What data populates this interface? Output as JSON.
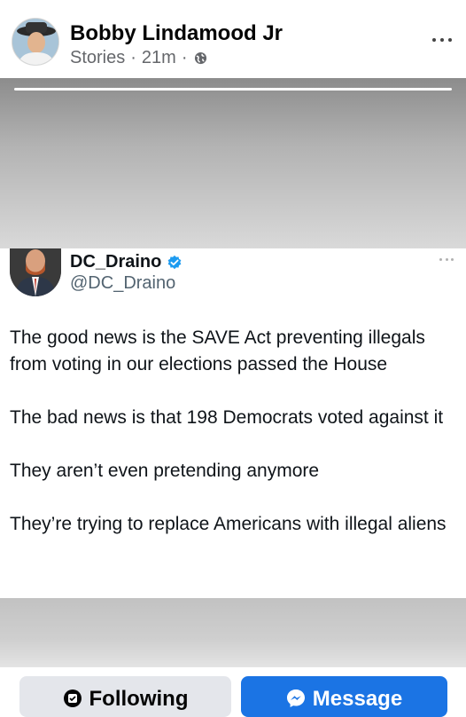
{
  "post": {
    "author_name": "Bobby Lindamood Jr",
    "source": "Stories",
    "separator": "·",
    "time_ago": "21m",
    "audience_icon": "globe-icon",
    "more_icon": "more-horizontal-icon"
  },
  "tweet": {
    "display_name": "DC_Draino",
    "verified_icon": "verified-badge-icon",
    "handle": "@DC_Draino",
    "paragraphs": [
      "The good news is the SAVE Act preventing illegals from voting in our elections passed the House",
      "The bad news is that 198 Democrats voted against it",
      "They aren’t even pretending anymore",
      "They’re trying to replace Americans with illegal aliens"
    ]
  },
  "actions": {
    "following_label": "Following",
    "following_icon": "following-check-icon",
    "message_label": "Message",
    "message_icon": "messenger-icon"
  },
  "colors": {
    "accent_blue": "#1b74e4",
    "verified_blue": "#1d9bf0",
    "secondary_button": "#e4e6eb",
    "meta_gray": "#65676b"
  }
}
